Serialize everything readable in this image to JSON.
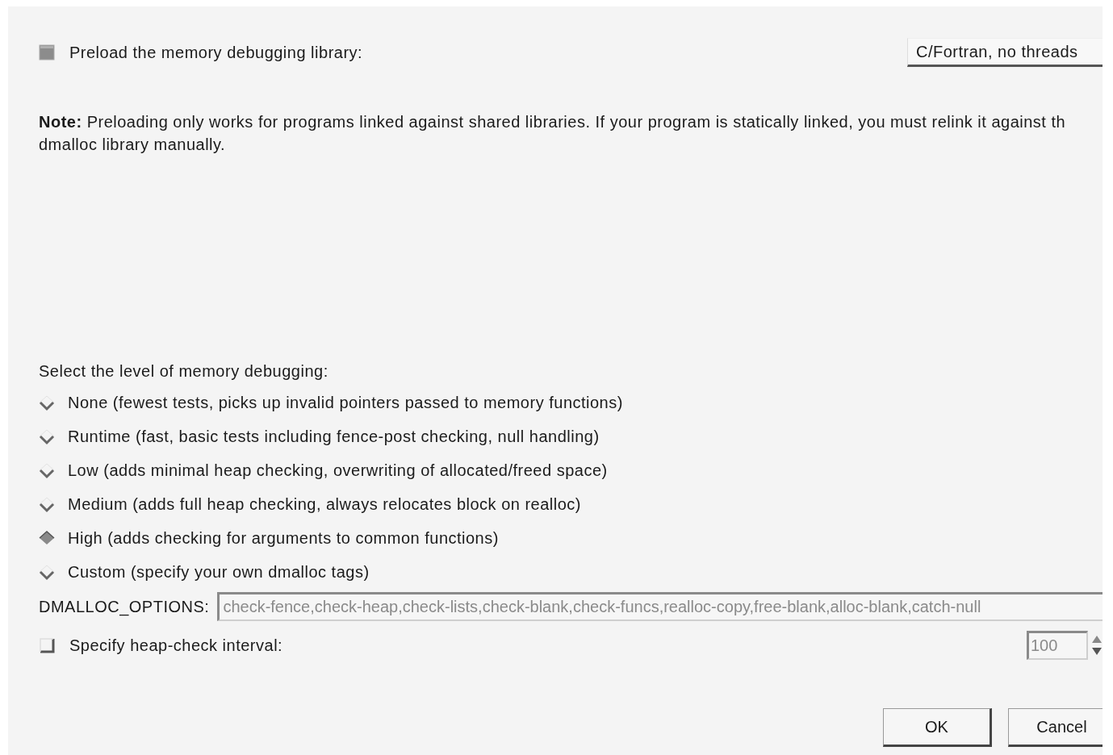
{
  "preload": {
    "label": "Preload the memory debugging library:",
    "checked": true,
    "library": "C/Fortran, no threads"
  },
  "note": {
    "lines": [
      "**Note:** Preloading only works for programs linked against shared libraries. If your program is statically linked, you must relink it against th",
      "dmalloc library manually."
    ]
  },
  "levels_title": "Select the level of memory debugging:",
  "levels": [
    {
      "label": "None (fewest tests, picks up invalid pointers passed to memory functions)",
      "selected": false
    },
    {
      "label": "Runtime (fast, basic tests including fence-post checking, null handling)",
      "selected": false
    },
    {
      "label": "Low (adds minimal heap checking, overwriting of allocated/freed space)",
      "selected": false
    },
    {
      "label": "Medium (adds full heap checking, always relocates block on realloc)",
      "selected": false
    },
    {
      "label": "High (adds checking for arguments to common functions)",
      "selected": true
    },
    {
      "label": "Custom (specify your own dmalloc tags)",
      "selected": false
    }
  ],
  "options": {
    "label": "DMALLOC_OPTIONS:",
    "value": "check-fence,check-heap,check-lists,check-blank,check-funcs,realloc-copy,free-blank,alloc-blank,catch-null",
    "disabled": true
  },
  "interval": {
    "label": "Specify heap-check interval:",
    "checked": false,
    "value": "100",
    "disabled": true
  },
  "buttons": [
    {
      "label": "OK"
    },
    {
      "label": "Cancel"
    }
  ]
}
